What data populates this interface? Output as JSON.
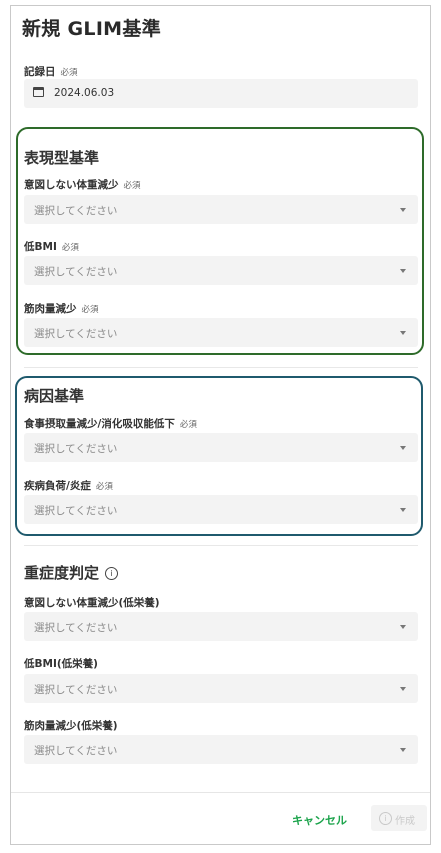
{
  "dialog": {
    "title": "新規 GLIM基準"
  },
  "required_tag": "必須",
  "record_date": {
    "label": "記録日",
    "value": "2024.06.03"
  },
  "phenotypic": {
    "title": "表現型基準",
    "fields": [
      {
        "label": "意図しない体重減少",
        "placeholder": "選択してください"
      },
      {
        "label": "低BMI",
        "placeholder": "選択してください"
      },
      {
        "label": "筋肉量減少",
        "placeholder": "選択してください"
      }
    ]
  },
  "etiologic": {
    "title": "病因基準",
    "fields": [
      {
        "label": "食事摂取量減少/消化吸収能低下",
        "placeholder": "選択してください"
      },
      {
        "label": "疾病負荷/炎症",
        "placeholder": "選択してください"
      }
    ]
  },
  "severity": {
    "title": "重症度判定",
    "info_icon": "info-icon",
    "fields": [
      {
        "label": "意図しない体重減少(低栄養)",
        "placeholder": "選択してください"
      },
      {
        "label": "低BMI(低栄養)",
        "placeholder": "選択してください"
      },
      {
        "label": "筋肉量減少(低栄養)",
        "placeholder": "選択してください"
      }
    ]
  },
  "footer": {
    "cancel_label": "キャンセル",
    "create_label": "作成"
  },
  "colors": {
    "phenotypic_border": "#2e6b2a",
    "etiologic_border": "#1f5a6d",
    "cancel_text": "#1aa34a"
  }
}
